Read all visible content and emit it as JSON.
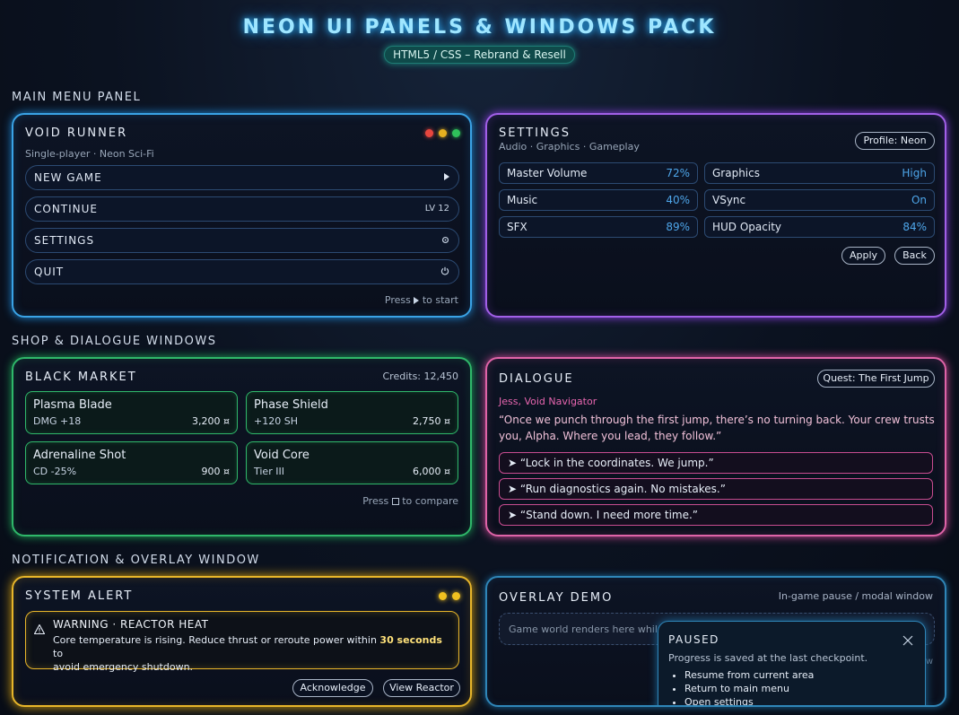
{
  "header": {
    "title": "NEON UI PANELS & WINDOWS PACK",
    "subtitle": "HTML5 / CSS – Rebrand & Resell"
  },
  "sections": {
    "main_menu": "MAIN MENU PANEL",
    "shop_dialogue": "SHOP & DIALOGUE WINDOWS",
    "notification": "NOTIFICATION & OVERLAY WINDOW"
  },
  "main_menu": {
    "title": "VOID RUNNER",
    "subtitle": "Single-player · Neon Sci-Fi",
    "dots": [
      "#e8463e",
      "#e6b020",
      "#2fc05a"
    ],
    "buttons": [
      {
        "label": "NEW GAME",
        "icon": "play-icon"
      },
      {
        "label": "CONTINUE",
        "badge": "LV 12"
      },
      {
        "label": "SETTINGS",
        "icon": "gear-icon"
      },
      {
        "label": "QUIT",
        "icon": "power-icon"
      }
    ],
    "hint_press": "Press",
    "hint_to_start": "to start"
  },
  "settings": {
    "title": "SETTINGS",
    "subtitle": "Audio · Graphics · Gameplay",
    "profile": "Profile: Neon",
    "left": [
      {
        "label": "Master Volume",
        "value": "72%"
      },
      {
        "label": "Music",
        "value": "40%"
      },
      {
        "label": "SFX",
        "value": "89%"
      }
    ],
    "right": [
      {
        "label": "Graphics",
        "value": "High"
      },
      {
        "label": "VSync",
        "value": "On"
      },
      {
        "label": "HUD Opacity",
        "value": "84%"
      }
    ],
    "apply": "Apply",
    "back": "Back"
  },
  "shop": {
    "title": "BLACK MARKET",
    "credits": "Credits: 12,450",
    "items": [
      {
        "name": "Plasma Blade",
        "stat": "DMG +18",
        "price": "3,200 ¤"
      },
      {
        "name": "Phase Shield",
        "stat": "+120 SH",
        "price": "2,750 ¤"
      },
      {
        "name": "Adrenaline Shot",
        "stat": "CD -25%",
        "price": "900 ¤"
      },
      {
        "name": "Void Core",
        "stat": "Tier III",
        "price": "6,000 ¤"
      }
    ],
    "hint_press": "Press",
    "hint_to_compare": "to compare"
  },
  "dialogue": {
    "title": "DIALOGUE",
    "quest": "Quest: The First Jump",
    "speaker": "Jess, Void Navigator",
    "line": "“Once we punch through the first jump, there’s no turning back. Your crew trusts you, Alpha. Where you lead, they follow.”",
    "choices": [
      "➤ “Lock in the coordinates. We jump.”",
      "➤ “Run diagnostics again. No mistakes.”",
      "➤ “Stand down. I need more time.”"
    ]
  },
  "alert": {
    "title": "SYSTEM ALERT",
    "dots": [
      "#f0c020",
      "#f0c020"
    ],
    "warning_title": "WARNING · REACTOR HEAT",
    "body_before": "Core temperature is rising. Reduce thrust or reroute power within ",
    "body_bold": "30 seconds",
    "body_after": " to",
    "body_line2": "avoid emergency shutdown.",
    "acknowledge": "Acknowledge",
    "view_reactor": "View Reactor"
  },
  "overlay": {
    "title": "OVERLAY DEMO",
    "subtitle": "In-game pause / modal window",
    "world_text": "Game world renders here while",
    "world_tail": "erview",
    "paused_title": "PAUSED",
    "paused_desc": "Progress is saved at the last checkpoint.",
    "paused_items": [
      "Resume from current area",
      "Return to main menu",
      "Open settings"
    ]
  },
  "colors": {
    "accent_blue": "#3aa3e6",
    "accent_purple": "#a260e8",
    "accent_green": "#2fb86a",
    "accent_pink": "#e064a8",
    "accent_yellow": "#e8b62a",
    "speaker_pink": "#e866b0"
  }
}
